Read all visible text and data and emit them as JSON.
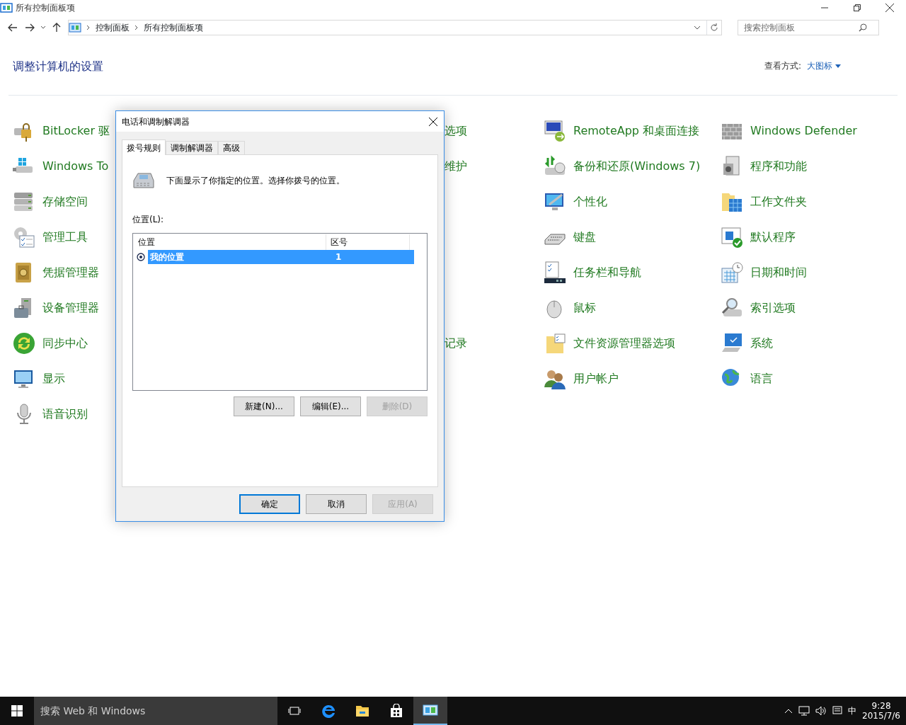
{
  "window": {
    "title": "所有控制面板项"
  },
  "address_bar": {
    "breadcrumbs": [
      "控制面板",
      "所有控制面板项"
    ]
  },
  "search": {
    "placeholder": "搜索控制面板"
  },
  "heading": "调整计算机的设置",
  "view": {
    "label": "查看方式:",
    "value": "大图标"
  },
  "item_columns": [
    {
      "items": [
        {
          "label": "BitLocker 驱"
        },
        {
          "label": "Windows To"
        },
        {
          "label": "存储空间"
        },
        {
          "label": "管理工具"
        },
        {
          "label": "凭据管理器"
        },
        {
          "label": "设备管理器"
        },
        {
          "label": "同步中心"
        },
        {
          "label": "显示"
        },
        {
          "label": "语音识别"
        }
      ]
    },
    {
      "items": [
        {
          "label": "选项"
        },
        {
          "label": "维护"
        },
        {
          "label": "记录"
        }
      ]
    },
    {
      "items": [
        {
          "label": "RemoteApp 和桌面连接"
        },
        {
          "label": "备份和还原(Windows 7)"
        },
        {
          "label": "个性化"
        },
        {
          "label": "键盘"
        },
        {
          "label": "任务栏和导航"
        },
        {
          "label": "鼠标"
        },
        {
          "label": "文件资源管理器选项"
        },
        {
          "label": "用户帐户"
        }
      ]
    },
    {
      "items": [
        {
          "label": "Windows Defender"
        },
        {
          "label": "程序和功能"
        },
        {
          "label": "工作文件夹"
        },
        {
          "label": "默认程序"
        },
        {
          "label": "日期和时间"
        },
        {
          "label": "索引选项"
        },
        {
          "label": "系统"
        },
        {
          "label": "语言"
        }
      ]
    }
  ],
  "dialog": {
    "title": "电话和调制解调器",
    "tabs": [
      {
        "label": "拨号规则",
        "selected": true
      },
      {
        "label": "调制解调器",
        "selected": false
      },
      {
        "label": "高级",
        "selected": false
      }
    ],
    "description": "下面显示了你指定的位置。选择你拨号的位置。",
    "list_label": "位置(L):",
    "table": {
      "columns": [
        "位置",
        "区号"
      ],
      "rows": [
        {
          "location": "我的位置",
          "area_code": "1",
          "selected": true,
          "current": true
        }
      ]
    },
    "list_buttons": [
      {
        "label": "新建(N)...",
        "disabled": false
      },
      {
        "label": "编辑(E)...",
        "disabled": false
      },
      {
        "label": "删除(D)",
        "disabled": true
      }
    ],
    "buttons": [
      {
        "label": "确定",
        "default": true,
        "disabled": false
      },
      {
        "label": "取消",
        "default": false,
        "disabled": false
      },
      {
        "label": "应用(A)",
        "default": false,
        "disabled": true
      }
    ]
  },
  "taskbar": {
    "search_placeholder": "搜索 Web 和 Windows",
    "apps": [
      {
        "selected": false
      },
      {
        "selected": false
      },
      {
        "selected": false
      },
      {
        "selected": false
      },
      {
        "selected": true
      }
    ],
    "ime": "中",
    "time": "9:28",
    "date": "2015/7/6"
  }
}
